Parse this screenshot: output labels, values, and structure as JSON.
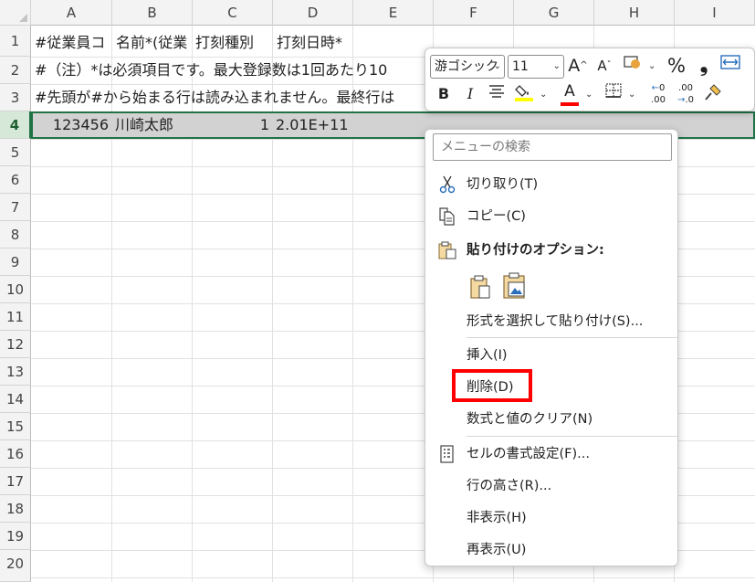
{
  "sheet": {
    "columns": [
      "A",
      "B",
      "C",
      "D",
      "E",
      "F",
      "G",
      "H",
      "I"
    ],
    "rows": [
      "1",
      "2",
      "3",
      "4",
      "5",
      "6",
      "7",
      "8",
      "9",
      "10",
      "11",
      "12",
      "13",
      "14",
      "15",
      "16",
      "17",
      "18",
      "19",
      "20"
    ],
    "cells": {
      "r1": "#従業員コ",
      "r1b": "名前*(従業",
      "r1c": "打刻種別",
      "r1d": "打刻日時*",
      "r2": "#（注）*は必須項目です。最大登録数は1回あたり10",
      "r3": "#先頭が#から始まる行は読み込まれません。最終行は",
      "r4a": "123456",
      "r4b": "川崎太郎",
      "r4c": "1",
      "r4d": "2.01E+11"
    }
  },
  "mini_toolbar": {
    "font_name": "游ゴシック",
    "font_size": "11",
    "grow_font": "A",
    "shrink_font": "A",
    "percent": "%",
    "comma": "❟",
    "bold": "B",
    "italic": "I",
    "font_color_letter": "A",
    "inc_decimal": ".00",
    "dec_decimal": ".00",
    "font_color": "#ff0000",
    "fill_color": "#ffff00"
  },
  "context_menu": {
    "search_placeholder": "メニューの検索",
    "cut": "切り取り(T)",
    "copy": "コピー(C)",
    "paste_options": "貼り付けのオプション:",
    "paste_special": "形式を選択して貼り付け(S)...",
    "insert": "挿入(I)",
    "delete": "削除(D)",
    "clear_contents": "数式と値のクリア(N)",
    "format_cells": "セルの書式設定(F)...",
    "row_height": "行の高さ(R)...",
    "hide": "非表示(H)",
    "unhide": "再表示(U)"
  },
  "colors": {
    "accent": "#217346",
    "highlight_box": "#ff0000"
  }
}
